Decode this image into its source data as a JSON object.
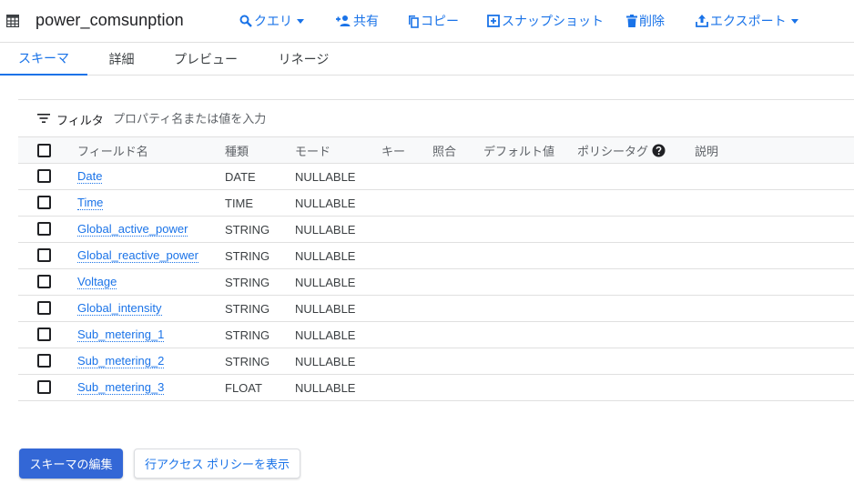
{
  "header": {
    "title": "power_comsunption",
    "actions": {
      "query": "クエリ",
      "share": "共有",
      "copy": "コピー",
      "snapshot": "スナップショット",
      "delete": "削除",
      "export": "エクスポート"
    }
  },
  "tabs": [
    "スキーマ",
    "詳細",
    "プレビュー",
    "リネージ"
  ],
  "active_tab": "スキーマ",
  "filter": {
    "label": "フィルタ",
    "placeholder": "プロパティ名または値を入力"
  },
  "table": {
    "columns": {
      "name": "フィールド名",
      "type": "種類",
      "mode": "モード",
      "key": "キー",
      "collation": "照合",
      "default": "デフォルト値",
      "policy": "ポリシータグ",
      "description": "説明"
    },
    "rows": [
      {
        "name": "Date",
        "type": "DATE",
        "mode": "NULLABLE"
      },
      {
        "name": "Time",
        "type": "TIME",
        "mode": "NULLABLE"
      },
      {
        "name": "Global_active_power",
        "type": "STRING",
        "mode": "NULLABLE"
      },
      {
        "name": "Global_reactive_power",
        "type": "STRING",
        "mode": "NULLABLE"
      },
      {
        "name": "Voltage",
        "type": "STRING",
        "mode": "NULLABLE"
      },
      {
        "name": "Global_intensity",
        "type": "STRING",
        "mode": "NULLABLE"
      },
      {
        "name": "Sub_metering_1",
        "type": "STRING",
        "mode": "NULLABLE"
      },
      {
        "name": "Sub_metering_2",
        "type": "STRING",
        "mode": "NULLABLE"
      },
      {
        "name": "Sub_metering_3",
        "type": "FLOAT",
        "mode": "NULLABLE"
      }
    ]
  },
  "buttons": {
    "edit_schema": "スキーマの編集",
    "row_access": "行アクセス ポリシーを表示"
  },
  "colors": {
    "accent": "#1a73e8",
    "primary_button": "#3367d6",
    "divider": "#e0e0e0",
    "header_bg": "#f8f9fa"
  },
  "icons": [
    "table-icon",
    "search-icon",
    "person-add-icon",
    "copy-icon",
    "snapshot-icon",
    "delete-icon",
    "export-icon",
    "filter-icon",
    "help-icon"
  ]
}
